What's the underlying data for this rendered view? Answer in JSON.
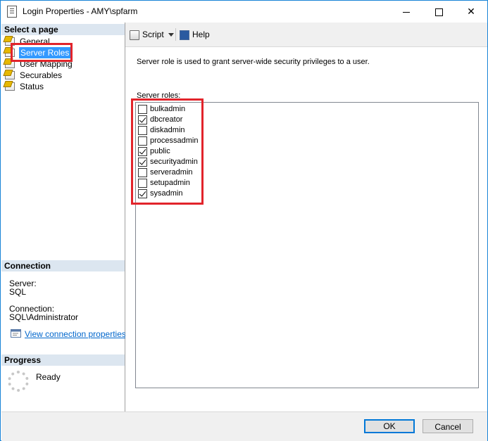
{
  "window": {
    "title": "Login Properties - AMY\\spfarm",
    "minimize_label": "—",
    "maximize_label": "☐",
    "close_label": "✕",
    "accent_color": "#1883d7"
  },
  "select_page": {
    "heading": "Select a page",
    "items": [
      {
        "label": "General",
        "icon": "page-icon"
      },
      {
        "label": "Server Roles",
        "icon": "page-icon",
        "selected": true
      },
      {
        "label": "User Mapping",
        "icon": "page-icon"
      },
      {
        "label": "Securables",
        "icon": "page-icon"
      },
      {
        "label": "Status",
        "icon": "page-icon"
      }
    ]
  },
  "connection": {
    "heading": "Connection",
    "server_label": "Server:",
    "server_value": "SQL",
    "connection_label": "Connection:",
    "connection_value": "SQL\\Administrator",
    "view_properties_link": "View connection properties"
  },
  "progress": {
    "heading": "Progress",
    "status": "Ready"
  },
  "toolbar": {
    "script_label": "Script",
    "help_label": "Help"
  },
  "main": {
    "description": "Server role is used to grant server-wide security privileges to a user.",
    "roles_label": "Server roles:",
    "roles": [
      {
        "name": "bulkadmin",
        "checked": false
      },
      {
        "name": "dbcreator",
        "checked": true
      },
      {
        "name": "diskadmin",
        "checked": false
      },
      {
        "name": "processadmin",
        "checked": false
      },
      {
        "name": "public",
        "checked": true
      },
      {
        "name": "securityadmin",
        "checked": true
      },
      {
        "name": "serveradmin",
        "checked": false
      },
      {
        "name": "setupadmin",
        "checked": false
      },
      {
        "name": "sysadmin",
        "checked": true
      }
    ]
  },
  "buttons": {
    "ok_label": "OK",
    "cancel_label": "Cancel"
  },
  "annotation_color": "#e2242b"
}
